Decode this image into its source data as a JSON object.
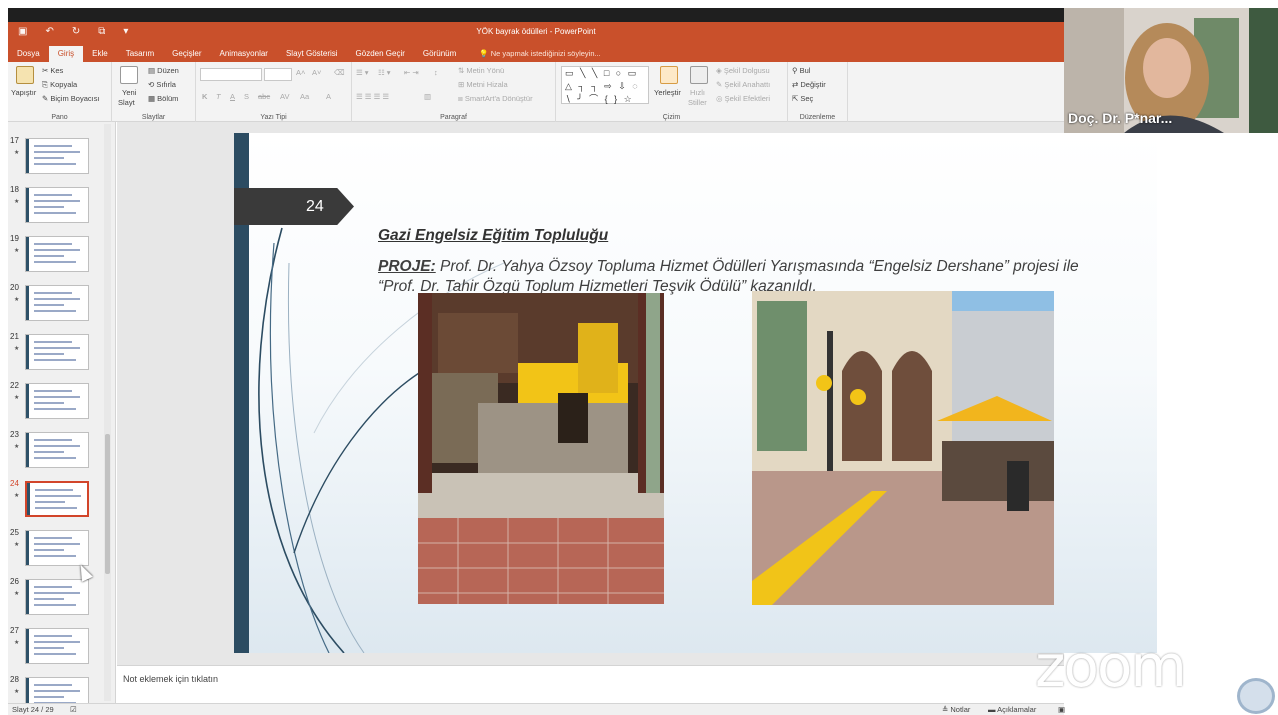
{
  "window": {
    "title": "YÖK bayrak ödülleri - PowerPoint",
    "qat_icons": [
      "save-icon",
      "undo-icon",
      "redo-icon",
      "present-icon",
      "customize-icon"
    ]
  },
  "tabs": [
    "Dosya",
    "Giriş",
    "Ekle",
    "Tasarım",
    "Geçişler",
    "Animasyonlar",
    "Slayt Gösterisi",
    "Gözden Geçir",
    "Görünüm"
  ],
  "active_tab": "Giriş",
  "tellme_placeholder": "Ne yapmak istediğinizi söyleyin...",
  "ribbon": {
    "pano": {
      "label": "Pano",
      "paste": "Yapıştır",
      "cut": "Kes",
      "copy": "Kopyala",
      "format_painter": "Biçim Boyacısı"
    },
    "slaytlar": {
      "label": "Slaytlar",
      "new_slide_1": "Yeni",
      "new_slide_2": "Slayt",
      "layout": "Düzen",
      "reset": "Sıfırla",
      "section": "Bölüm"
    },
    "yazitipi": {
      "label": "Yazı Tipi",
      "bold": "K",
      "italic": "T",
      "underline": "A",
      "shadow": "S",
      "strike": "abc",
      "font_color": "A"
    },
    "paragraf": {
      "label": "Paragraf",
      "text_direction": "Metin Yönü",
      "align_text": "Metni Hizala",
      "smartart": "SmartArt'a Dönüştür"
    },
    "cizim": {
      "label": "Çizim",
      "arrange": "Yerleştir",
      "quick_styles_1": "Hızlı",
      "quick_styles_2": "Stiller",
      "fill": "Şekil Dolgusu",
      "outline": "Şekil Anahattı",
      "effects": "Şekil Efektleri",
      "shapes": "▭ ╲ ╲ □ ○ ▭ △ ┐ ┐ ⇨ ⇩ ◌ ∖ ╯ ⌒ { } ☆"
    },
    "duzenleme": {
      "label": "Düzenleme",
      "find": "Bul",
      "replace": "Değiştir",
      "select": "Seç"
    }
  },
  "thumbnails": [
    {
      "num": "17",
      "selected": false
    },
    {
      "num": "18",
      "selected": false
    },
    {
      "num": "19",
      "selected": false
    },
    {
      "num": "20",
      "selected": false
    },
    {
      "num": "21",
      "selected": false
    },
    {
      "num": "22",
      "selected": false
    },
    {
      "num": "23",
      "selected": false
    },
    {
      "num": "24",
      "selected": true
    },
    {
      "num": "25",
      "selected": false
    },
    {
      "num": "26",
      "selected": false
    },
    {
      "num": "27",
      "selected": false
    },
    {
      "num": "28",
      "selected": false
    }
  ],
  "thumb_star": "★",
  "slide": {
    "number": "24",
    "heading": "Gazi Engelsiz Eğitim Topluluğu",
    "project_label": "PROJE:",
    "project_text": " Prof. Dr. Yahya Özsoy Topluma Hizmet Ödülleri Yarışmasında “Engelsiz Dershane” projesi ile “Prof. Dr. Tahir Özgü Toplum Hizmetleri Teşvik Ödülü” kazanıldı."
  },
  "notes_placeholder": "Not eklemek için tıklatın",
  "status": {
    "slide_counter": "Slayt 24 / 29",
    "notes": "Notlar",
    "comments": "Açıklamalar"
  },
  "zoom": {
    "participant_name": "Doç. Dr. P*nar...",
    "logo_text": "zoom"
  }
}
